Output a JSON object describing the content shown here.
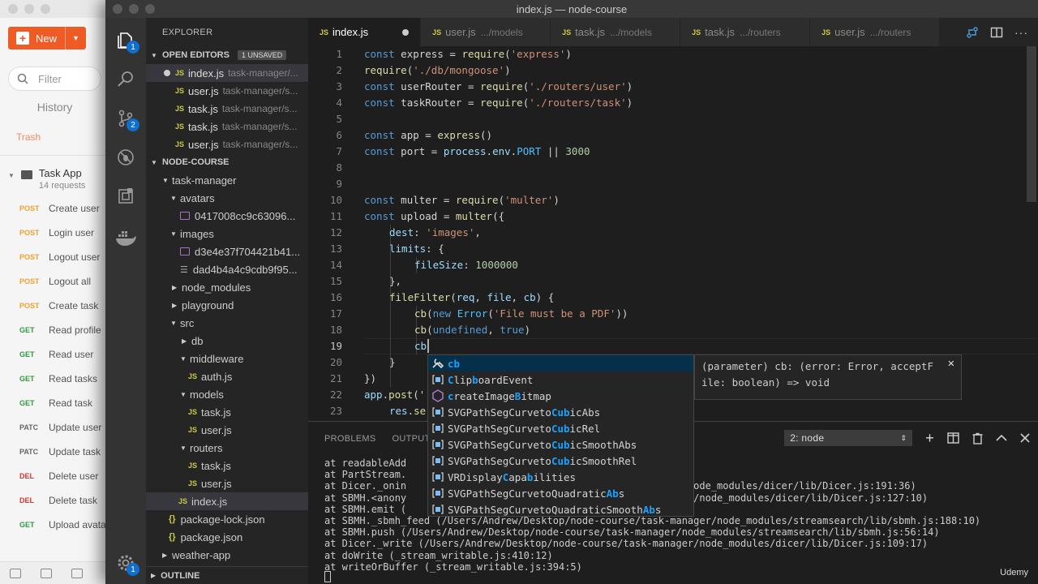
{
  "window": {
    "title": "index.js — node-course"
  },
  "postman": {
    "new_label": "New",
    "filter_placeholder": "Filter",
    "history_label": "History",
    "trash_label": "Trash",
    "collection": {
      "name": "Task App",
      "count": "14 requests"
    },
    "requests": [
      {
        "method": "POST",
        "name": "Create user"
      },
      {
        "method": "POST",
        "name": "Login user"
      },
      {
        "method": "POST",
        "name": "Logout user"
      },
      {
        "method": "POST",
        "name": "Logout all"
      },
      {
        "method": "POST",
        "name": "Create task"
      },
      {
        "method": "GET",
        "name": "Read profile"
      },
      {
        "method": "GET",
        "name": "Read user"
      },
      {
        "method": "GET",
        "name": "Read tasks"
      },
      {
        "method": "GET",
        "name": "Read task"
      },
      {
        "method": "PATC",
        "name": "Update user"
      },
      {
        "method": "PATC",
        "name": "Update task"
      },
      {
        "method": "DEL",
        "name": "Delete user"
      },
      {
        "method": "DEL",
        "name": "Delete task"
      },
      {
        "method": "GET",
        "name": "Upload avatar"
      }
    ]
  },
  "activity": {
    "explorer_badge": "1",
    "scm_badge": "2",
    "settings_badge": "1"
  },
  "sidebar": {
    "title": "EXPLORER",
    "open_editors_label": "OPEN EDITORS",
    "unsaved_label": "1 UNSAVED",
    "open_editors": [
      {
        "name": "index.js",
        "path": "task-manager/..."
      },
      {
        "name": "user.js",
        "path": "task-manager/s..."
      },
      {
        "name": "task.js",
        "path": "task-manager/s..."
      },
      {
        "name": "task.js",
        "path": "task-manager/s..."
      },
      {
        "name": "user.js",
        "path": "task-manager/s..."
      }
    ],
    "project_label": "NODE-COURSE",
    "tree": {
      "task_manager": "task-manager",
      "avatars": "avatars",
      "avatar_file": "0417008cc9c63096...",
      "images": "images",
      "image_file1": "d3e4e37f704421b41...",
      "image_file2": "dad4b4a4c9cdb9f95...",
      "node_modules": "node_modules",
      "playground": "playground",
      "src": "src",
      "db": "db",
      "middleware": "middleware",
      "auth": "auth.js",
      "models": "models",
      "models_task": "task.js",
      "models_user": "user.js",
      "routers": "routers",
      "routers_task": "task.js",
      "routers_user": "user.js",
      "index": "index.js",
      "package_lock": "package-lock.json",
      "package": "package.json",
      "weather_app": "weather-app"
    },
    "outline_label": "OUTLINE"
  },
  "tabs": [
    {
      "name": "index.js",
      "path": ""
    },
    {
      "name": "user.js",
      "path": ".../models"
    },
    {
      "name": "task.js",
      "path": ".../models"
    },
    {
      "name": "task.js",
      "path": ".../routers"
    },
    {
      "name": "user.js",
      "path": ".../routers"
    }
  ],
  "editor": {
    "current_line": "19",
    "lines": {
      "l1": [
        "const",
        " express = ",
        "require",
        "(",
        "'express'",
        ")"
      ],
      "l2": [
        "require",
        "(",
        "'./db/mongoose'",
        ")"
      ],
      "l3": [
        "const",
        " userRouter = ",
        "require",
        "(",
        "'./routers/user'",
        ")"
      ],
      "l4": [
        "const",
        " taskRouter = ",
        "require",
        "(",
        "'./routers/task'",
        ")"
      ],
      "l6": [
        "const",
        " app = ",
        "express",
        "()"
      ],
      "l7": [
        "const",
        " port = ",
        "process",
        ".",
        "env",
        ".",
        "PORT",
        " || ",
        "3000"
      ],
      "l10": [
        "const",
        " multer = ",
        "require",
        "(",
        "'multer'",
        ")"
      ],
      "l11": [
        "const",
        " upload = ",
        "multer",
        "({"
      ],
      "l12": [
        "dest",
        ": ",
        "'images'",
        ","
      ],
      "l13": [
        "limits",
        ": {"
      ],
      "l14": [
        "fileSize",
        ": ",
        "1000000"
      ],
      "l15": [
        "},"
      ],
      "l16": [
        "fileFilter",
        "(",
        "req",
        ", ",
        "file",
        ", ",
        "cb",
        ") {"
      ],
      "l17": [
        "cb",
        "(",
        "new",
        " ",
        "Error",
        "(",
        "'File must be a PDF'",
        "))"
      ],
      "l18": [
        "cb",
        "(",
        "undefined",
        ", ",
        "true",
        ")"
      ],
      "l19": [
        "cb"
      ],
      "l20": [
        "}"
      ],
      "l21": [
        "})"
      ],
      "l22": [
        "app",
        ".",
        "post",
        "('"
      ],
      "l23": [
        "res",
        ".",
        "se"
      ]
    }
  },
  "suggest": [
    {
      "icon": "variable-icon",
      "pre": "",
      "match": "cb",
      "post": "",
      "match2": "",
      "post2": "",
      "match3": "",
      "post3": ""
    },
    {
      "icon": "class-icon",
      "pre": "",
      "match": "C",
      "post": "lip",
      "match2": "b",
      "post2": "oardEvent",
      "match3": "",
      "post3": ""
    },
    {
      "icon": "method-icon",
      "pre": "",
      "match": "c",
      "post": "reateImage",
      "match2": "B",
      "post2": "itmap",
      "match3": "",
      "post3": ""
    },
    {
      "icon": "class-icon",
      "pre": "SVGPathSegCurveto",
      "match": "Cub",
      "post": "icAbs",
      "match2": "",
      "post2": "",
      "match3": "",
      "post3": ""
    },
    {
      "icon": "class-icon",
      "pre": "SVGPathSegCurveto",
      "match": "Cub",
      "post": "icRel",
      "match2": "",
      "post2": "",
      "match3": "",
      "post3": ""
    },
    {
      "icon": "class-icon",
      "pre": "SVGPathSegCurveto",
      "match": "Cub",
      "post": "icSmoothAbs",
      "match2": "",
      "post2": "",
      "match3": "",
      "post3": ""
    },
    {
      "icon": "class-icon",
      "pre": "SVGPathSegCurveto",
      "match": "Cub",
      "post": "icSmoothRel",
      "match2": "",
      "post2": "",
      "match3": "",
      "post3": ""
    },
    {
      "icon": "class-icon",
      "pre": "VRDisplay",
      "match": "C",
      "post": "apa",
      "match2": "b",
      "post2": "ilities",
      "match3": "",
      "post3": ""
    },
    {
      "icon": "class-icon",
      "pre": "SVGPathSegCurveto",
      "match": "",
      "post": "Quadratic",
      "match2": "Ab",
      "post2": "s",
      "match3": "",
      "post3": ""
    },
    {
      "icon": "class-icon",
      "pre": "SVGPathSegCurveto",
      "match": "",
      "post": "QuadraticSmooth",
      "match2": "Ab",
      "post2": "s",
      "match3": "",
      "post3": ""
    }
  ],
  "details": {
    "line1": "(parameter) cb: (error: Error, acceptF",
    "line2": "ile: boolean) => void"
  },
  "panel": {
    "problems_label": "PROBLEMS",
    "output_label": "OUTPUT",
    "terminal_select": "2: node",
    "terminal_lines": [
      "at readableAdd",
      "at PartStream.",
      "at Dicer._onin                                          nager/node_modules/dicer/lib/Dicer.js:191:36)",
      "at SBMH.<anony                                          manager/node_modules/dicer/lib/Dicer.js:127:10)",
      "at SBMH.emit (",
      "at SBMH._sbmh_feed (/Users/Andrew/Desktop/node-course/task-manager/node_modules/streamsearch/lib/sbmh.js:188:10)",
      "at SBMH.push (/Users/Andrew/Desktop/node-course/task-manager/node_modules/streamsearch/lib/sbmh.js:56:14)",
      "at Dicer._write (/Users/Andrew/Desktop/node-course/task-manager/node_modules/dicer/lib/Dicer.js:109:17)",
      "at doWrite (_stream_writable.js:410:12)",
      "at writeOrBuffer (_stream_writable.js:394:5)"
    ]
  },
  "watermark": "Udemy"
}
